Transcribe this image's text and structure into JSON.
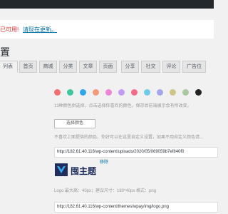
{
  "notice": {
    "text": "已可用!",
    "link": "请现在更新。"
  },
  "page": {
    "title": "置"
  },
  "tabs": [
    {
      "label": "列表",
      "active": true
    },
    {
      "label": "首页"
    },
    {
      "label": "商城"
    },
    {
      "label": "分类"
    },
    {
      "label": "文章"
    },
    {
      "label": "页面"
    },
    {
      "label": "分享"
    },
    {
      "label": "社交"
    },
    {
      "label": "评论"
    },
    {
      "label": "广告位"
    }
  ],
  "colors": [
    {
      "name": "coral",
      "hex": "#f36e6e"
    },
    {
      "name": "green",
      "hex": "#3cc79c"
    },
    {
      "name": "blue",
      "hex": "#2ea7ea"
    },
    {
      "name": "salmon",
      "hex": "#f49a7b"
    },
    {
      "name": "pink",
      "hex": "#ee84d7"
    },
    {
      "name": "purple",
      "hex": "#c29bf2"
    },
    {
      "name": "rose",
      "hex": "#f26c87"
    },
    {
      "name": "sky",
      "hex": "#6ecbe9"
    },
    {
      "name": "lavender",
      "hex": "#a5a5ee"
    },
    {
      "name": "khaki",
      "hex": "#cfc589"
    },
    {
      "name": "sage",
      "hex": "#a9c8a0"
    },
    {
      "name": "black",
      "hex": "#222222"
    }
  ],
  "help": {
    "color_desc": "13种颜色供选择，点击选择你喜欢的颜色，保存后前端展示会有所改变。",
    "custom_desc": "不喜欢上面提供的颜色，你好可以在这里自定义设置，如果不用自定义颜色请...",
    "logo_desc": "Logo 最大高：40px；建议尺寸：180*40px 格式：png"
  },
  "buttons": {
    "select_color": "选择颜色"
  },
  "fields": {
    "image_url": "http://182.61.40.116/wp-content/uploads/2020/05/069059b7ef840f0",
    "logo_url": "http://182.61.40.116/wp-content/themes/wpay/img/logo.png"
  },
  "logo": {
    "text": "囤主题"
  },
  "links": {
    "remove": "移除"
  }
}
